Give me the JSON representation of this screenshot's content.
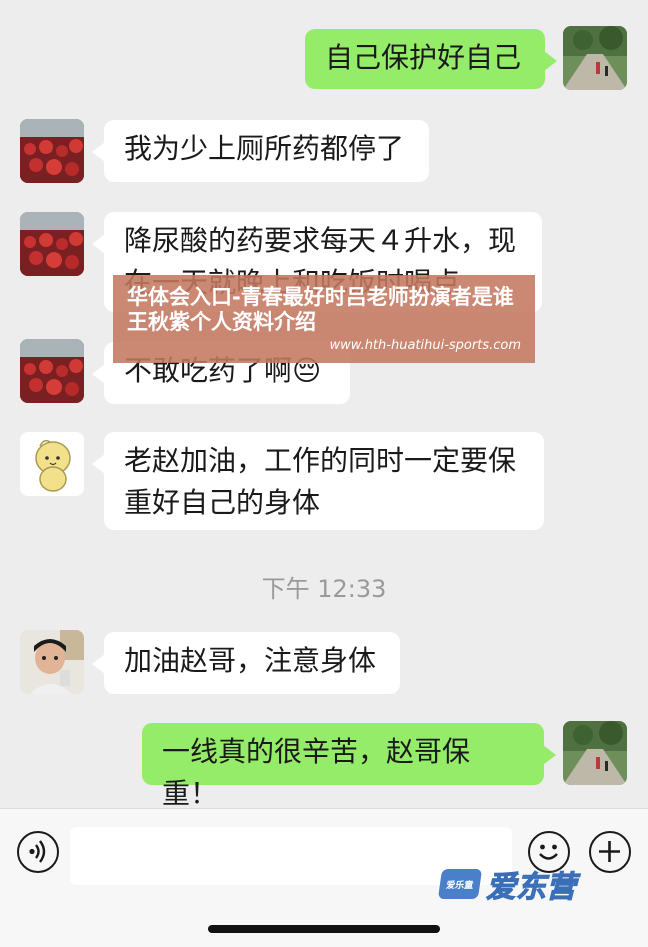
{
  "messages": [
    {
      "id": "m1",
      "direction": "out",
      "text": "自己保护好自己",
      "avatar": "landscape-walk-avatar"
    },
    {
      "id": "m2",
      "direction": "in",
      "text": "我为少上厕所药都停了",
      "avatar": "red-flowers-avatar"
    },
    {
      "id": "m3",
      "direction": "in",
      "text_line1": "降尿酸的药要求每天４升水，现",
      "text_line2": "在一天就晚上和吃饭时喝点",
      "avatar": "red-flowers-avatar"
    },
    {
      "id": "m4",
      "direction": "in",
      "text": "不敢吃药了啊",
      "emoji": "😔",
      "avatar": "red-flowers-avatar"
    },
    {
      "id": "m5",
      "direction": "in",
      "text_line1": "老赵加油，工作的同时一定要保",
      "text_line2": "重好自己的身体",
      "avatar": "cartoon-chick-avatar"
    },
    {
      "id": "m6",
      "direction": "in",
      "text": "加油赵哥，注意身体",
      "avatar": "child-photo-avatar"
    },
    {
      "id": "m7",
      "direction": "out",
      "text": "一线真的很辛苦，赵哥保重！",
      "avatar": "landscape-walk-avatar"
    }
  ],
  "timestamp": "下午 12:33",
  "overlay": {
    "title": "华体会入口-青春最好时吕老师扮演者是谁 王秋紫个人资料介绍",
    "url": "www.hth-huatihui-sports.com"
  },
  "input_bar": {
    "voice_icon": "voice-icon",
    "emoji_icon": "emoji-icon",
    "plus_icon": "plus-icon"
  },
  "watermark": {
    "logo_text": "爱乐童",
    "text": "爱东营"
  },
  "colors": {
    "background": "#ededed",
    "incoming_bubble": "#ffffff",
    "outgoing_bubble": "#95ec69",
    "overlay": "#c47860",
    "watermark": "#5b8fd8"
  }
}
